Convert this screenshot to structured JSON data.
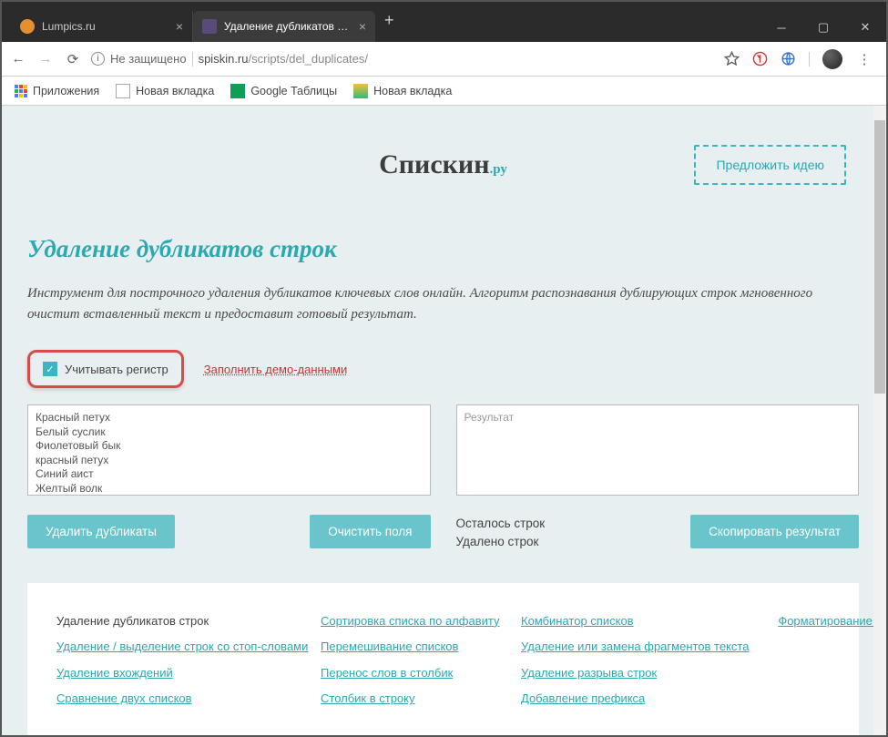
{
  "window": {
    "tabs": [
      {
        "label": "Lumpics.ru"
      },
      {
        "label": "Удаление дубликатов строк - у..."
      }
    ]
  },
  "address": {
    "insecure_label": "Не защищено",
    "host": "spiskin.ru",
    "path": "/scripts/del_duplicates/"
  },
  "bookmarks": {
    "apps": "Приложения",
    "newtab1": "Новая вкладка",
    "sheets": "Google Таблицы",
    "newtab2": "Новая вкладка"
  },
  "page": {
    "logo_main": "Спискин",
    "logo_sub": ".ру",
    "suggest": "Предложить идею",
    "title": "Удаление дубликатов строк",
    "description": "Инструмент для построчного удаления дубликатов ключевых слов онлайн. Алгоритм распознавания дублирующих строк мгновенного очистит вставленный текст и предоставит готовый результат.",
    "case_label": "Учитывать регистр",
    "fill_demo": "Заполнить демо-данными",
    "input_text": "Красный петух\nБелый суслик\nФиолетовый бык\nкрасный петух\nСиний аист\nЖелтый волк\nОранжевый медведь\nСиний аист",
    "result_placeholder": "Результат",
    "btn_delete": "Удалить дубликаты",
    "btn_clear": "Очистить поля",
    "btn_copy": "Скопировать результат",
    "stats_remaining": "Осталось строк",
    "stats_removed": "Удалено строк"
  },
  "footer": {
    "col1_head": "Удаление дубликатов строк",
    "col1": [
      "Удаление / выделение строк со стоп-словами",
      "Удаление вхождений",
      "Сравнение двух списков"
    ],
    "col2": [
      "Сортировка списка по алфавиту",
      "Перемешивание списков",
      "Перенос слов в столбик",
      "Столбик в строку"
    ],
    "col3": [
      "Комбинатор списков",
      "Удаление или замена фрагментов текста",
      "Удаление разрыва строк",
      "Добавление префикса"
    ],
    "col4": [
      "Форматирование списка"
    ]
  }
}
